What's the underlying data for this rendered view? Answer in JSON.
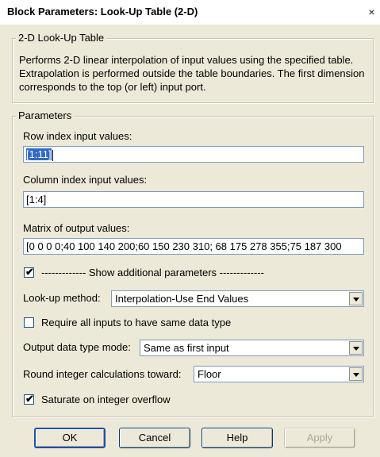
{
  "window": {
    "title": "Block Parameters: Look-Up Table (2-D)",
    "close_glyph": "×"
  },
  "block_group": {
    "legend": "2-D Look-Up Table",
    "description": "Performs 2-D linear interpolation of input values using the specified table. Extrapolation is performed outside the table boundaries.  The first dimension corresponds to the top (or left) input port."
  },
  "params_group": {
    "legend": "Parameters",
    "row_index": {
      "label": "Row index input values:",
      "value": "[1:11]"
    },
    "col_index": {
      "label": "Column index input values:",
      "value": "[1:4]"
    },
    "matrix": {
      "label": "Matrix of output values:",
      "value": "[0 0 0 0;40 100 140 200;60 150 230 310; 68 175 278 355;75 187 300"
    },
    "show_additional": {
      "label": "------------- Show additional parameters -------------",
      "checked": true
    },
    "lookup_method": {
      "label": "Look-up method:",
      "value": "Interpolation-Use End Values"
    },
    "require_same_type": {
      "label": "Require all inputs to have same data type",
      "checked": false
    },
    "output_type_mode": {
      "label": "Output data type mode:",
      "value": "Same as first input"
    },
    "round_toward": {
      "label": "Round integer calculations toward:",
      "value": "Floor"
    },
    "saturate": {
      "label": "Saturate on integer overflow",
      "checked": true
    }
  },
  "buttons": {
    "ok": "OK",
    "cancel": "Cancel",
    "help": "Help",
    "apply": "Apply"
  },
  "colors": {
    "dialog_bg": "#ece9d8",
    "selection": "#316ac5",
    "input_border": "#7f9db9"
  }
}
